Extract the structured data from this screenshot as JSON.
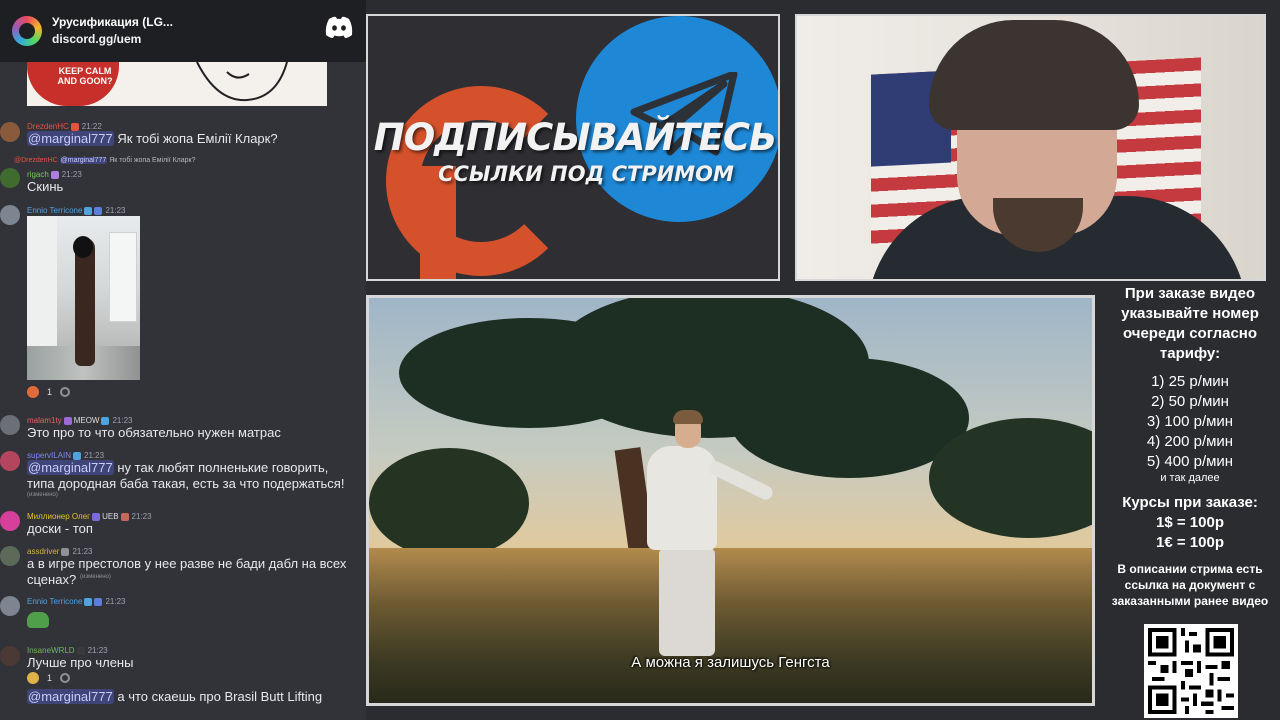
{
  "chat": {
    "server_name": "Урусификация (LG...",
    "server_invite": "discord.gg/uem",
    "meme_text": "KEEP CALM AND GOON?",
    "messages": [
      {
        "user": "DrezdenHC",
        "time": "21:22",
        "user_color": "#e2543e",
        "mention": "@marginal777",
        "text": "Як тобі жопа Емілії Кларк?"
      },
      {
        "user": "rigach",
        "time": "21:23",
        "user_color": "#6fcf4f",
        "reply_user": "@DrezdenHC",
        "reply_mention": "@marginal777",
        "reply_text": "Як тобі жопа Емілії Кларк?",
        "text": "Скинь"
      },
      {
        "user": "Ennio Terricone",
        "time": "21:23",
        "user_color": "#4fa3e0",
        "reaction_count": "1"
      },
      {
        "user": "malam1ty",
        "time": "21:23",
        "user_color": "#e46262",
        "tag": "MEOW",
        "text": "Это про то что обязательно нужен матрас"
      },
      {
        "user": "supervILAIN",
        "time": "21:23",
        "user_color": "#7b87f2",
        "mention": "@marginal777",
        "text": "ну так любят полненькие говорить, типа дородная баба такая, есть за что подержаться!",
        "edited": "(изменено)"
      },
      {
        "user": "Миллионер Олег",
        "time": "21:23",
        "user_color": "#e6c229",
        "tag": "UEB",
        "text": "доски - топ"
      },
      {
        "user": "assdriver",
        "time": "21:23",
        "user_color": "#d4b33a",
        "text": "а в игре престолов у нее разве не бади дабл на всех сценах?",
        "edited": "(изменено)"
      },
      {
        "user": "Ennio Terricone",
        "time": "21:23",
        "user_color": "#4fa3e0"
      },
      {
        "user": "InsaneWRLD",
        "time": "21:23",
        "user_color": "#6dba5a",
        "text": "Лучше про члены",
        "reaction_count": "1"
      },
      {
        "mention": "@marginal777",
        "text": "а что скаешь про Brasil Butt Lifting"
      }
    ]
  },
  "promo": {
    "title": "ПОДПИСЫВАЙТЕСЬ",
    "subtitle": "ССЫЛКИ ПОД СТРИМОМ",
    "telegram_color": "#1e88d6",
    "patreon_color": "#d4512b"
  },
  "video": {
    "subtitle": "А можна я залишусь Генгста"
  },
  "info": {
    "heading": "При заказе видео указывайте номер очереди согласно тарифу:",
    "tariffs": [
      "1) 25 р/мин",
      "2) 50 р/мин",
      "3) 100 р/мин",
      "4) 200 р/мин",
      "5) 400 р/мин"
    ],
    "tariff_more": "и так далее",
    "rates_title": "Курсы при заказе:",
    "rates": [
      "1$ = 100р",
      "1€ = 100р"
    ],
    "footer": "В описании стрима есть ссылка на документ с заказанными ранее видео"
  }
}
